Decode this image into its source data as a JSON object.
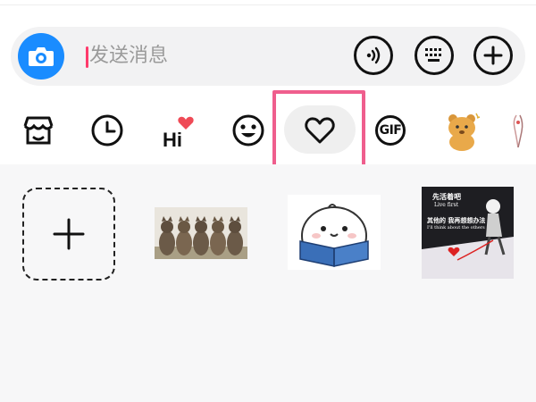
{
  "input": {
    "placeholder": "发送消息"
  },
  "tabs": [
    {
      "icon": "store-icon"
    },
    {
      "icon": "clock-icon"
    },
    {
      "icon": "hi-heart-icon",
      "label": "Hi"
    },
    {
      "icon": "smiley-icon"
    },
    {
      "icon": "heart-icon",
      "active": true
    },
    {
      "icon": "gif-icon",
      "label": "GIF"
    },
    {
      "icon": "bear-sticker-icon"
    },
    {
      "icon": "partial-sticker-icon"
    }
  ],
  "favorites": {
    "items": [
      {
        "name": "cats-gif"
      },
      {
        "name": "reading-bun"
      },
      {
        "name": "quote-card",
        "lines": [
          "先活着吧",
          "Live first",
          "其他的 我再想想办法",
          "I'll think about the others"
        ]
      }
    ]
  },
  "colors": {
    "accent": "#1a8cff",
    "highlight": "#ef5e8d",
    "caret": "#ff3b6b"
  }
}
